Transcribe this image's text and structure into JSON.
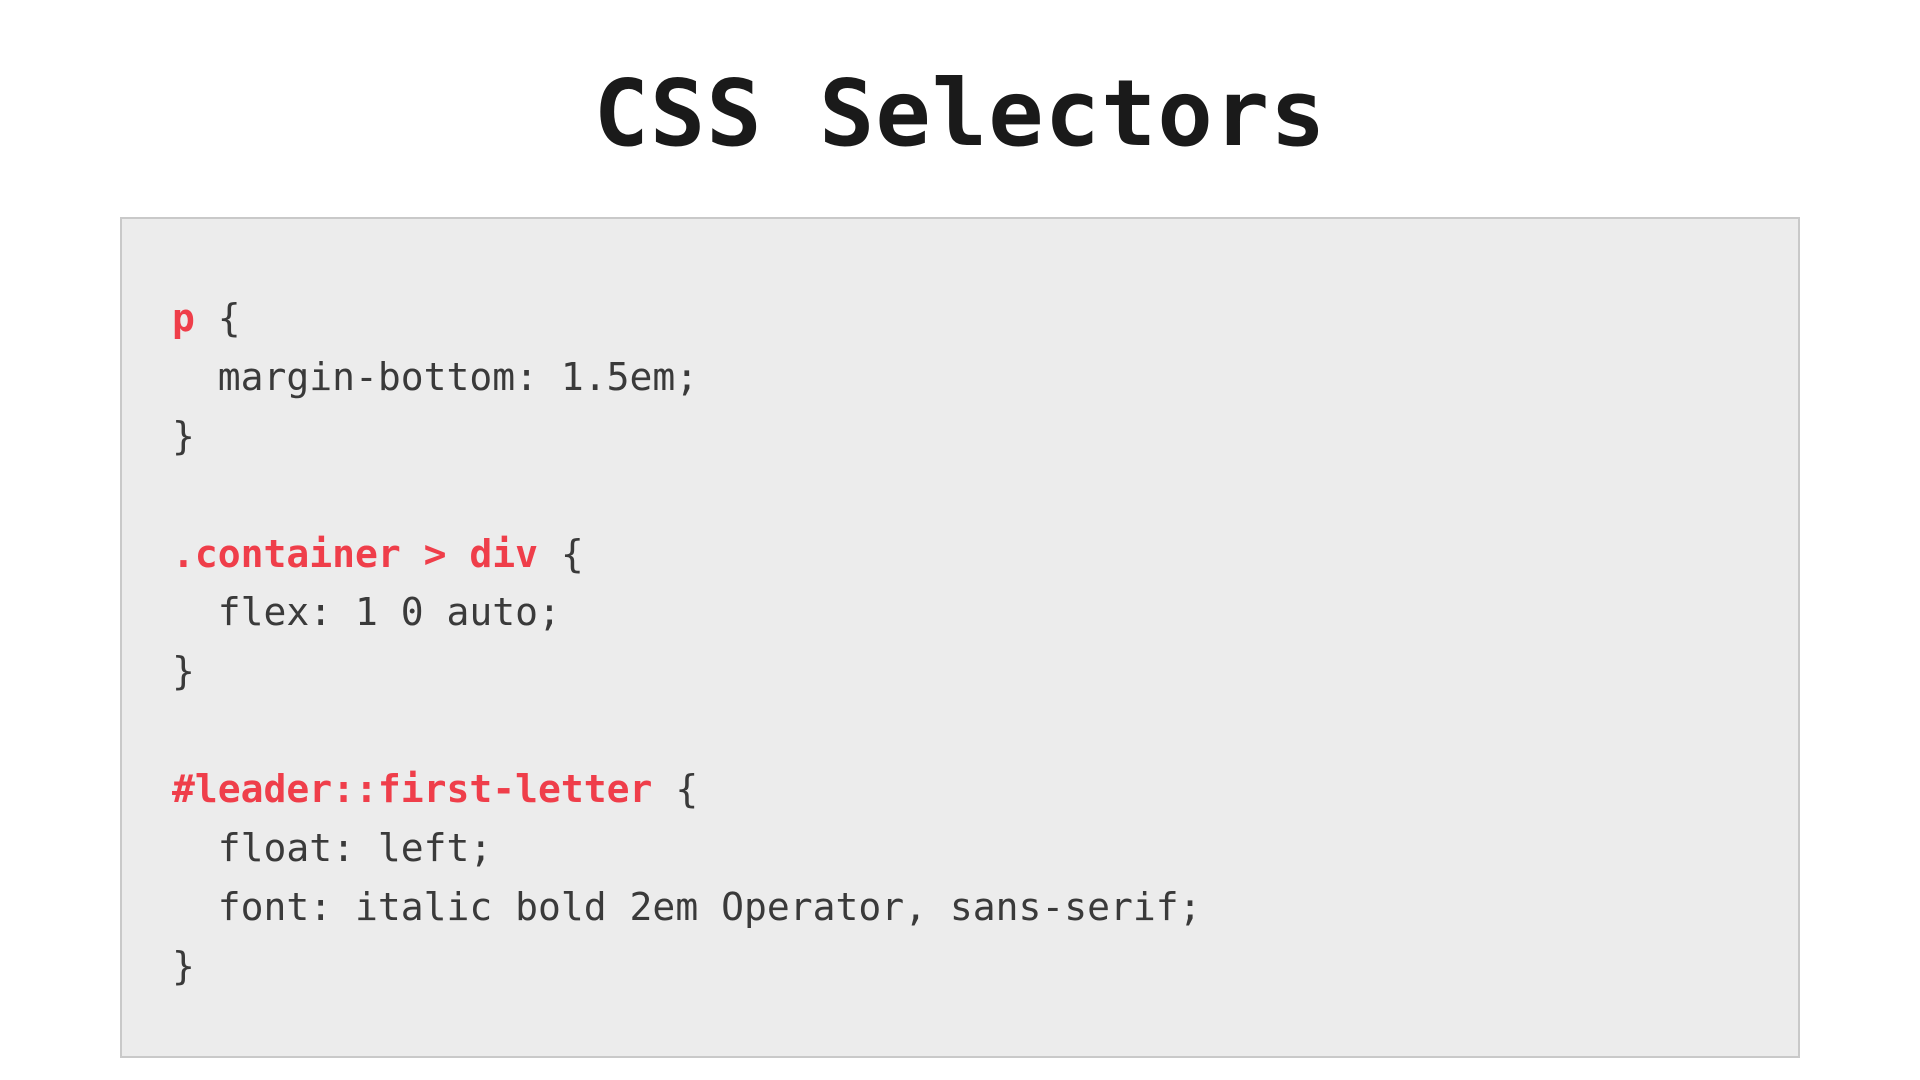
{
  "title": "CSS Selectors",
  "colors": {
    "selector": "#ef3e4a",
    "code_bg": "#ececec",
    "code_border": "#c9c9c9",
    "text": "#3a3a3a"
  },
  "code": {
    "rules": [
      {
        "selector": "p",
        "open": " {",
        "declarations": [
          "  margin-bottom: 1.5em;"
        ],
        "close": "}"
      },
      {
        "selector": ".container > div",
        "open": " {",
        "declarations": [
          "  flex: 1 0 auto;"
        ],
        "close": "}"
      },
      {
        "selector": "#leader::first-letter",
        "open": " {",
        "declarations": [
          "  float: left;",
          "  font: italic bold 2em Operator, sans-serif;"
        ],
        "close": "}"
      }
    ]
  }
}
